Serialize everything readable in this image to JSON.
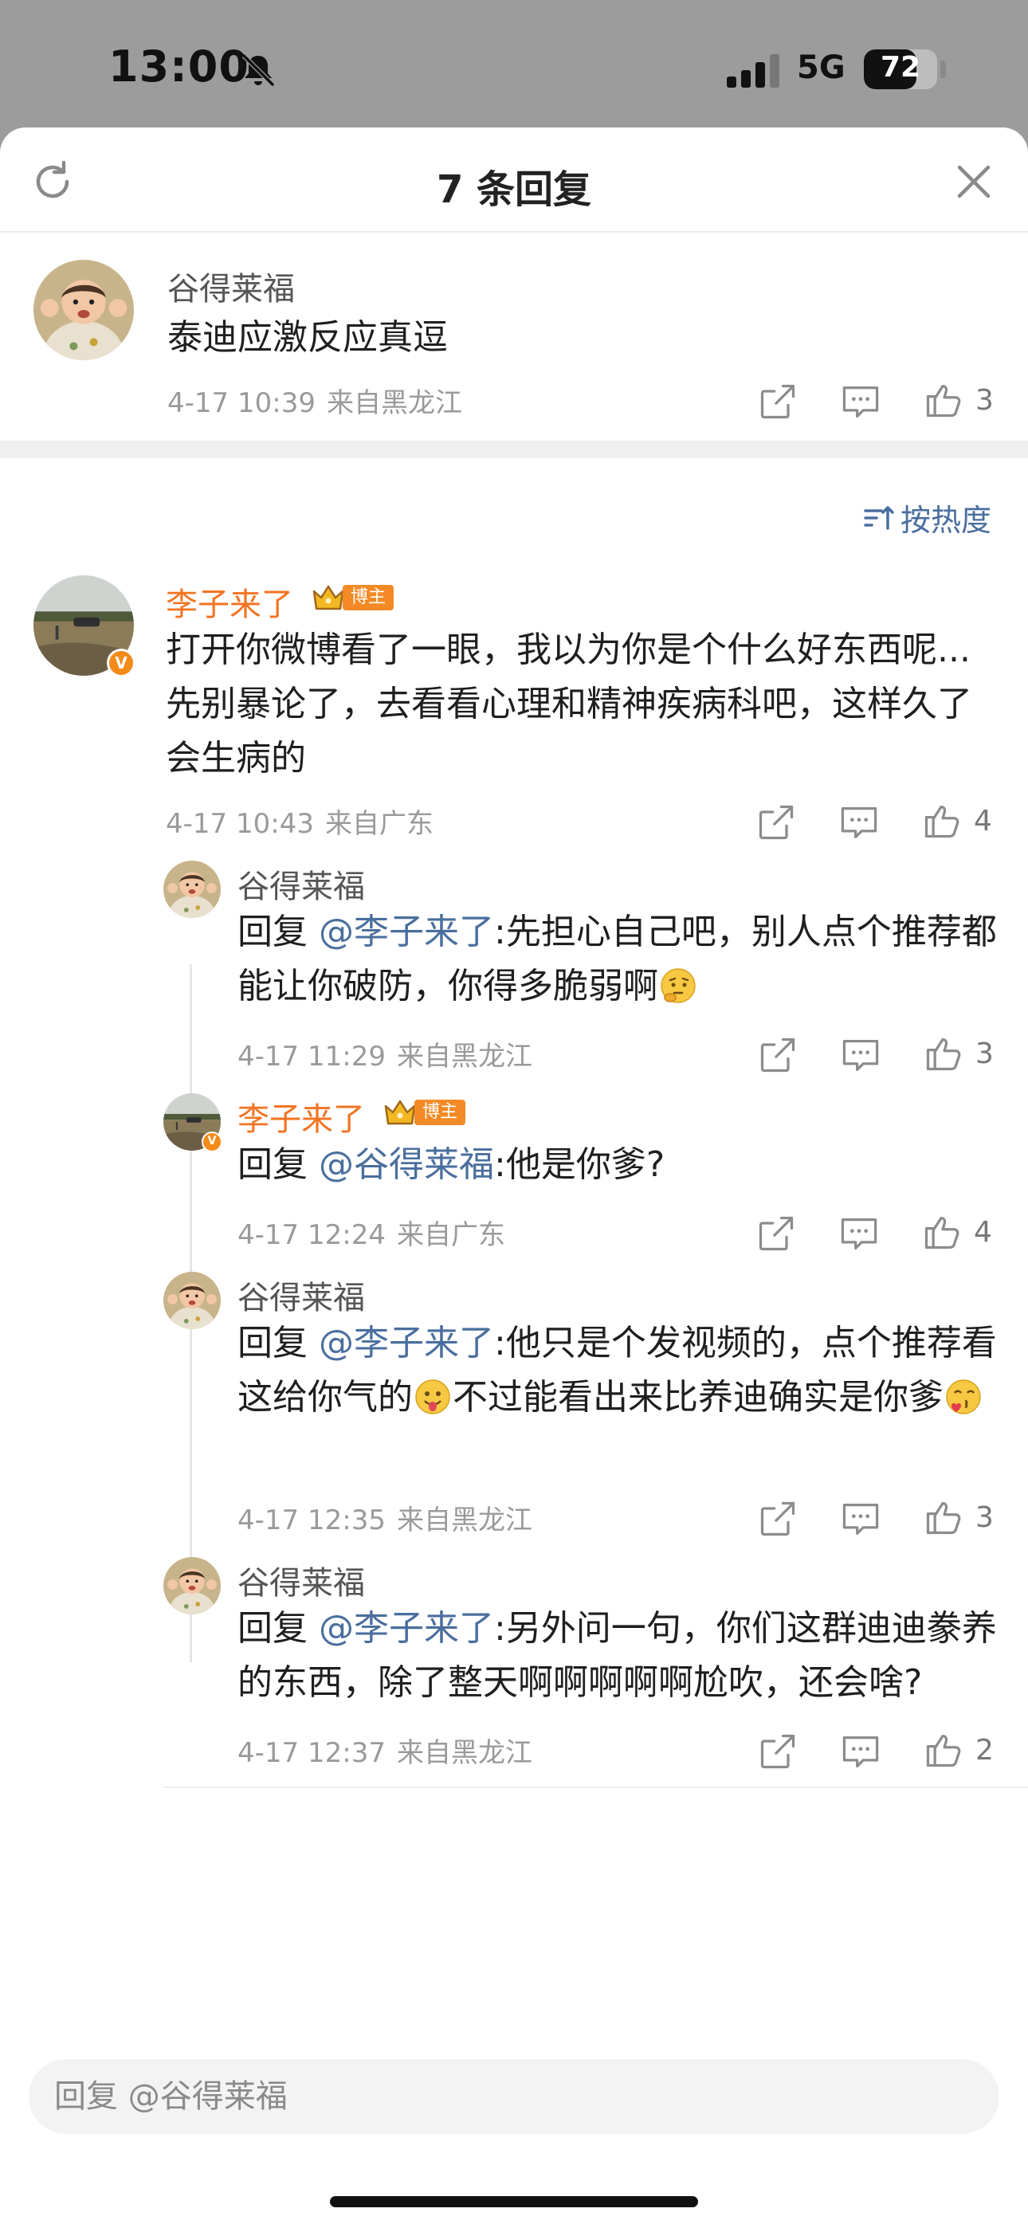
{
  "status_bar": {
    "time": "13:00",
    "network": "5G",
    "battery_level": "72",
    "battery_fraction": 0.72
  },
  "header": {
    "title": "7 条回复"
  },
  "root_comment": {
    "username": "谷得莱福",
    "text": "泰迪应激反应真逗",
    "date": "4-17 10:39",
    "location": "来自黑龙江",
    "likes": "3"
  },
  "sort": {
    "label": "按热度"
  },
  "badge": {
    "label": "博主"
  },
  "replies": [
    {
      "username": "李子来了",
      "text": "打开你微博看了一眼，我以为你是个什么好东西呢...先别暴论了，去看看心理和精神疾病科吧，这样久了会生病的",
      "date": "4-17 10:43",
      "location": "来自广东",
      "likes": "4"
    },
    {
      "username": "谷得莱福",
      "prefix": "回复",
      "mention": "@李子来了",
      "text_a": ":先担心自己吧，别人点个推荐都能让你破防，你得多脆弱啊",
      "date": "4-17 11:29",
      "location": "来自黑龙江",
      "likes": "3"
    },
    {
      "username": "李子来了",
      "prefix": "回复",
      "mention": "@谷得莱福",
      "text_a": ":他是你爹?",
      "date": "4-17 12:24",
      "location": "来自广东",
      "likes": "4"
    },
    {
      "username": "谷得莱福",
      "prefix": "回复",
      "mention": "@李子来了",
      "text_a": ":他只是个发视频的，点个推荐看这给你气的",
      "text_b": "不过能看出来比养迪确实是你爹",
      "date": "4-17 12:35",
      "location": "来自黑龙江",
      "likes": "3"
    },
    {
      "username": "谷得莱福",
      "prefix": "回复",
      "mention": "@李子来了",
      "text_a": ":另外问一句，你们这群迪迪豢养的东西，除了整天啊啊啊啊啊尬吹，还会啥?",
      "date": "4-17 12:37",
      "location": "来自黑龙江",
      "likes": "2"
    }
  ],
  "reply_input": {
    "placeholder": "回复 @谷得莱福"
  },
  "colors": {
    "author_name": "#f37321",
    "mention": "#4a6e9e",
    "meta": "#9a9a9a"
  }
}
